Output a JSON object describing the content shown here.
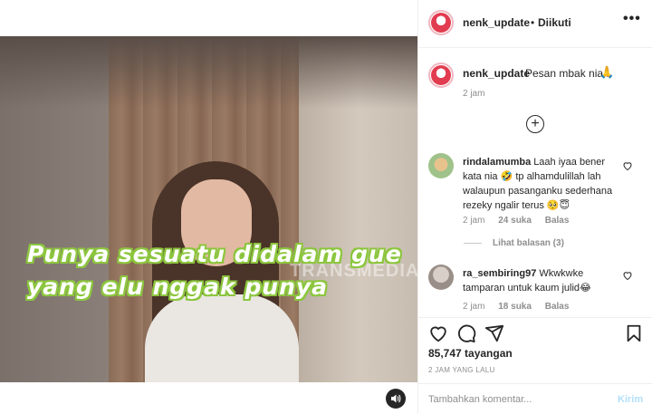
{
  "video": {
    "caption_line1": "Punya sesuatu didalam gue",
    "caption_line2": "yang elu nggak punya",
    "watermark": "TRANSMEDIA",
    "caption_color": "#8cc63e"
  },
  "header": {
    "username": "nenk_update",
    "dot": "•",
    "follow_status": "Diikuti",
    "more_label": "•••"
  },
  "post": {
    "username": "nenk_update",
    "caption": "Pesan mbak nia...",
    "caption_emoji": "🙏",
    "time": "2 jam"
  },
  "load_more_label": "+",
  "comments": [
    {
      "username": "rindalamumba",
      "text": "Laah iyaa bener kata nia 🤣 tp alhamdulillah lah walaupun pasanganku sederhana rezeky ngalir terus 🥺😇",
      "time": "2 jam",
      "likes": "24 suka",
      "reply": "Balas",
      "view_replies": "Lihat balasan (3)"
    },
    {
      "username": "ra_sembiring97",
      "text": "Wkwkwke tamparan untuk kaum julid😂",
      "time": "2 jam",
      "likes": "18 suka",
      "reply": "Balas"
    }
  ],
  "stats": {
    "views": "85,747 tayangan",
    "posted_ago": "2 JAM YANG LALU"
  },
  "add_comment": {
    "placeholder": "Tambahkan komentar...",
    "post_label": "Kirim"
  },
  "colors": {
    "text": "#262626",
    "secondary": "#8e8e8e",
    "link_disabled": "#b2dffc",
    "border": "#efefef"
  }
}
